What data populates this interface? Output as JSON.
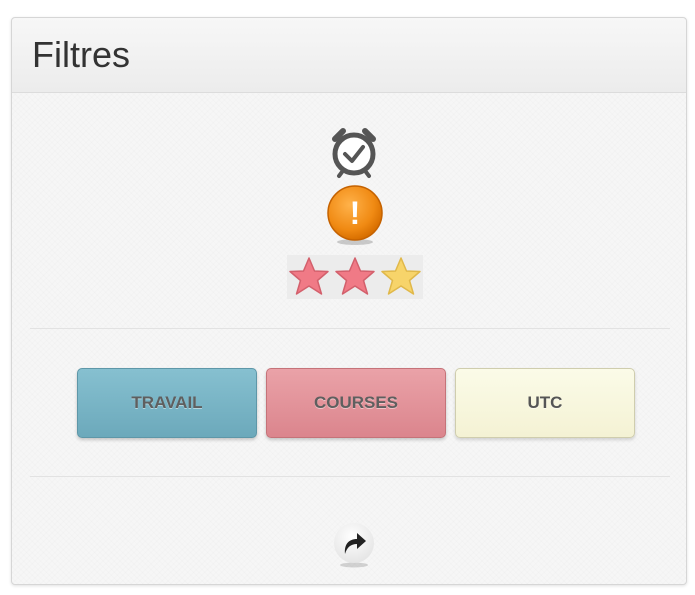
{
  "panel": {
    "title": "Filtres"
  },
  "icons": {
    "alarm": "alarm-clock-icon",
    "priority": "exclamation-icon",
    "rating": "star-icon",
    "reset": "redo-arrow-icon"
  },
  "rating": {
    "filled": 2,
    "total": 3,
    "filled_color": "#f07a86",
    "empty_color": "#f7d46a"
  },
  "priority": {
    "symbol": "!",
    "color": "#f08a13"
  },
  "tags": [
    {
      "label": "TRAVAIL",
      "color": "#78b4c6"
    },
    {
      "label": "COURSES",
      "color": "#e3939a"
    },
    {
      "label": "UTC",
      "color": "#f8f6dc"
    }
  ]
}
